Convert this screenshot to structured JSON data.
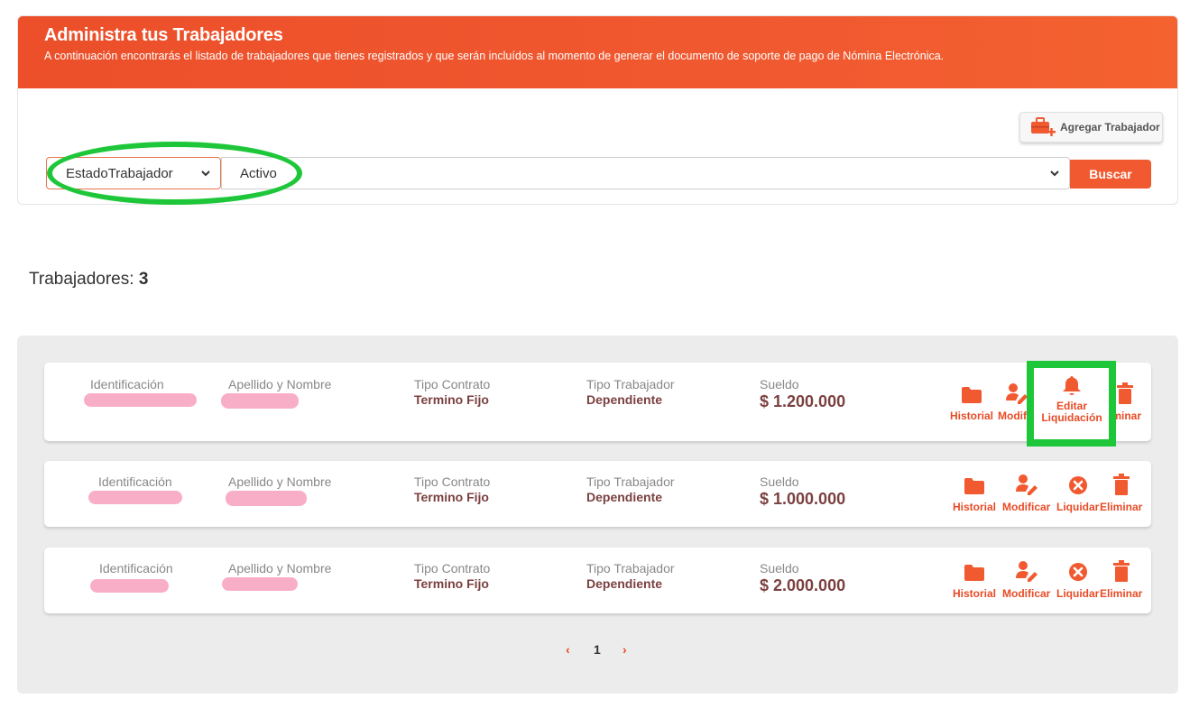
{
  "header": {
    "title": "Administra tus Trabajadores",
    "subtitle": "A continuación encontrarás el listado de trabajadores que tienes registrados y que serán incluídos al momento de generar el documento de soporte de pago de Nómina Electrónica."
  },
  "toolbar": {
    "add_label": "Agregar Trabajador",
    "filter_field": "EstadoTrabajador",
    "filter_value": "Activo",
    "search_label": "Buscar"
  },
  "summary": {
    "label": "Trabajadores:",
    "count": "3"
  },
  "labels": {
    "id": "Identificación",
    "name": "Apellido y Nombre",
    "contract": "Tipo Contrato",
    "worker_type": "Tipo Trabajador",
    "salary": "Sueldo"
  },
  "actions": {
    "history": "Historial",
    "modify": "Modificar",
    "liquidate": "Liquidar",
    "delete": "Eliminar",
    "edit_liq_1": "Editar",
    "edit_liq_2": "Liquidación",
    "modify_clipped": "Modific",
    "delete_clipped": "iminar"
  },
  "workers": [
    {
      "contract": "Termino Fijo",
      "worker_type": "Dependiente",
      "salary": "$ 1.200.000"
    },
    {
      "contract": "Termino Fijo",
      "worker_type": "Dependiente",
      "salary": "$ 1.000.000"
    },
    {
      "contract": "Termino Fijo",
      "worker_type": "Dependiente",
      "salary": "$ 2.000.000"
    }
  ],
  "pagination": {
    "prev": "‹",
    "page": "1",
    "next": "›"
  },
  "colors": {
    "brand": "#f15a30",
    "highlight": "#1ec739",
    "value_text": "#7b4040"
  }
}
